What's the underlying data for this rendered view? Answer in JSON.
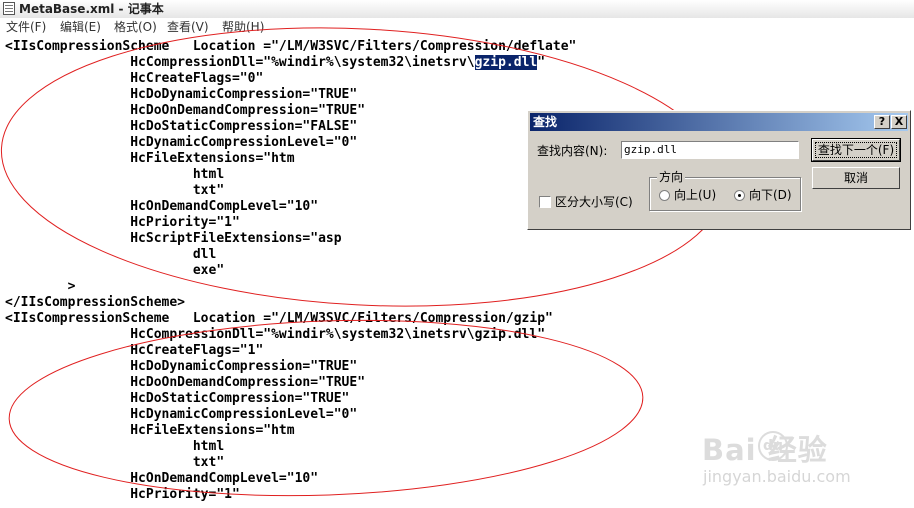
{
  "window": {
    "title": "MetaBase.xml - 记事本"
  },
  "menu": {
    "file": "文件(F)",
    "edit": "编辑(E)",
    "format": "格式(O)",
    "view": "查看(V)",
    "help": "帮助(H)"
  },
  "editor": {
    "block1": {
      "line1": "<IIsCompressionScheme   Location =\"/LM/W3SVC/Filters/Compression/deflate\"",
      "line2_pre": "                HcCompressionDll=\"%windir%\\system32\\inetsrv\\",
      "line2_sel": "gzip.dll",
      "line2_post": "\"",
      "lines": [
        "                HcCreateFlags=\"0\"",
        "                HcDoDynamicCompression=\"TRUE\"",
        "                HcDoOnDemandCompression=\"TRUE\"",
        "                HcDoStaticCompression=\"FALSE\"",
        "                HcDynamicCompressionLevel=\"0\"",
        "                HcFileExtensions=\"htm",
        "                        html",
        "                        txt\"",
        "                HcOnDemandCompLevel=\"10\"",
        "                HcPriority=\"1\"",
        "                HcScriptFileExtensions=\"asp",
        "                        dll",
        "                        exe\"",
        "        >",
        "</IIsCompressionScheme>"
      ]
    },
    "block2": {
      "lines": [
        "<IIsCompressionScheme   Location =\"/LM/W3SVC/Filters/Compression/gzip\"",
        "                HcCompressionDll=\"%windir%\\system32\\inetsrv\\gzip.dll\"",
        "                HcCreateFlags=\"1\"",
        "                HcDoDynamicCompression=\"TRUE\"",
        "                HcDoOnDemandCompression=\"TRUE\"",
        "                HcDoStaticCompression=\"TRUE\"",
        "                HcDynamicCompressionLevel=\"0\"",
        "                HcFileExtensions=\"htm",
        "                        html",
        "                        txt\"",
        "                HcOnDemandCompLevel=\"10\"",
        "                HcPriority=\"1\""
      ]
    }
  },
  "find_dialog": {
    "title": "查找",
    "help_btn": "?",
    "close_btn": "X",
    "find_label": "查找内容(N):",
    "find_value": "gzip.dll",
    "find_next": "查找下一个(F)",
    "cancel": "取消",
    "direction_label": "方向",
    "up_label": "向上(U)",
    "down_label": "向下(D)",
    "match_case_label": "区分大小写(C)",
    "direction": "down",
    "match_case": false
  },
  "watermark": {
    "brand": "Bai   经验",
    "paw": "du",
    "sub": "jingyan.baidu.com"
  },
  "colors": {
    "selection": "#0a246a",
    "annotation": "#e02020",
    "dialog_face": "#d4d0c8"
  }
}
